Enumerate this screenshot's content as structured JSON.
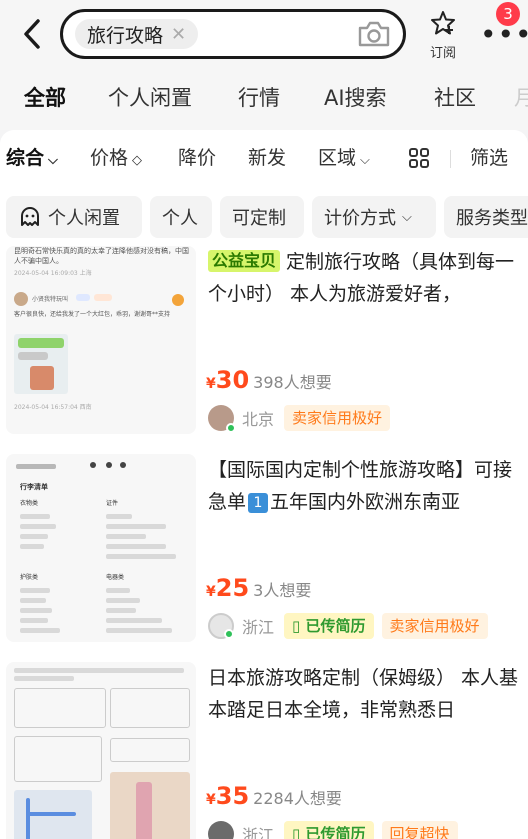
{
  "header": {
    "search_chip": "旅行攻略",
    "subscribe_label": "订阅",
    "more_badge": "3"
  },
  "tabs": [
    {
      "label": "全部",
      "active": true
    },
    {
      "label": "个人闲置"
    },
    {
      "label": "行情"
    },
    {
      "label": "AI搜索"
    },
    {
      "label": "社区"
    },
    {
      "label": "月"
    }
  ],
  "sort_bar": [
    {
      "label": "综合",
      "active": true
    },
    {
      "label": "价格"
    },
    {
      "label": "降价"
    },
    {
      "label": "新发"
    },
    {
      "label": "区域"
    },
    {
      "label": "筛选"
    }
  ],
  "filters": [
    "个人闲置",
    "个人",
    "可定制",
    "计价方式",
    "服务类型"
  ],
  "items": [
    {
      "tag": "公益宝贝",
      "title": "定制旅行攻略（具体到每一个小时） 本人为旅游爱好者，",
      "price": "30",
      "price_symbol": "¥",
      "want": "398人想要",
      "location": "北京",
      "badges": [
        {
          "text": "卖家信用极好",
          "kind": "orange"
        }
      ],
      "thumb": {
        "top_text": "昆明奇石常快乐真的真的太幸了连降他感对没有稿，中国人不骗中国人。",
        "date1": "2024-05-04 16:09:03 上海",
        "user": "小贤我特玩叫",
        "comment": "客户很良快，还给我发了一个大红包，乖羽，谢谢哥**支持",
        "date2": "2024-05-04 16:57:04 西南"
      }
    },
    {
      "title_prefix": "【国际国内定制个性旅游攻略】可接急单",
      "title_num": "1",
      "title_suffix": "五年国内外欧洲东南亚",
      "price": "25",
      "price_symbol": "¥",
      "want": "3人想要",
      "location": "浙江",
      "badges": [
        {
          "text": "已传简历",
          "kind": "green"
        },
        {
          "text": "卖家信用极好",
          "kind": "orange"
        }
      ],
      "thumb": {
        "head": "行李清单",
        "col1": "衣物类",
        "col2": "证件",
        "sec3": "护肤类",
        "sec4": "电器类"
      }
    },
    {
      "title": "日本旅游攻略定制（保姆级） 本人基本踏足日本全境，非常熟悉日",
      "price": "35",
      "price_symbol": "¥",
      "want": "2284人想要",
      "location": "浙江",
      "badges": [
        {
          "text": "已传简历",
          "kind": "green"
        },
        {
          "text": "回复超快",
          "kind": "orange"
        }
      ]
    }
  ],
  "colors": {
    "accent_yellow": "#ffe600",
    "price_red": "#ff4a1c",
    "badge_red": "#ff3b4a",
    "green": "#2f9a2f",
    "orange": "#ff7a1a"
  },
  "icons": [
    "back-icon",
    "clear-icon",
    "camera-icon",
    "star-subscribe-icon",
    "more-icon",
    "chevron-down-icon",
    "sort-arrows-icon",
    "grid-icon",
    "ghost-icon",
    "resume-icon"
  ]
}
